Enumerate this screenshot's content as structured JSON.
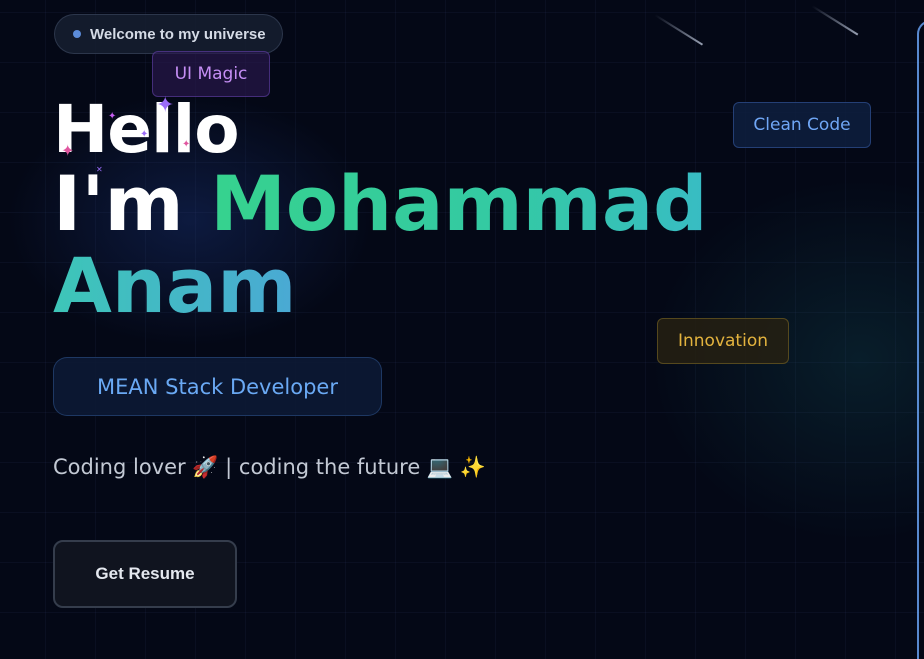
{
  "welcome": {
    "text": "Welcome to my universe"
  },
  "floating_tags": {
    "ui_magic": "UI Magic",
    "clean_code": "Clean Code",
    "innovation": "Innovation"
  },
  "hero": {
    "greeting": "Hello",
    "intro": "I'm",
    "first_name": "Mohammad",
    "last_name": "Anam"
  },
  "role": {
    "label": "MEAN Stack Developer"
  },
  "tagline": {
    "text": "Coding lover 🚀 | coding the future 💻 ✨"
  },
  "actions": {
    "resume_label": "Get Resume"
  },
  "colors": {
    "background": "#040816",
    "accent_green": "#36d28e",
    "accent_teal": "#38bcc4",
    "accent_blue": "#6aa9f4",
    "accent_purple": "#c58ef5",
    "accent_gold": "#e3b33e"
  },
  "icons": {
    "welcome_dot": "status-dot-icon",
    "sparkles": "sparkle-icon"
  }
}
